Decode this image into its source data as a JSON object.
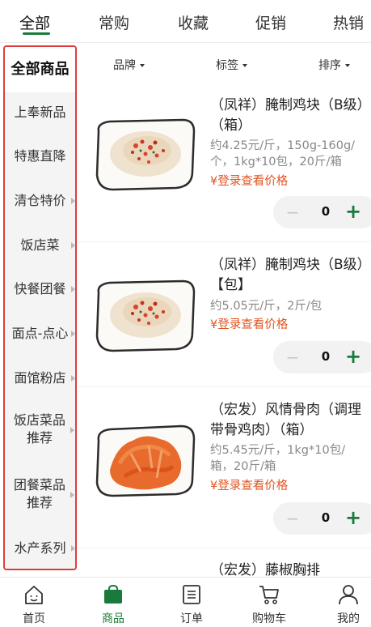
{
  "top_tabs": [
    {
      "label": "全部",
      "active": true
    },
    {
      "label": "常购",
      "active": false
    },
    {
      "label": "收藏",
      "active": false
    },
    {
      "label": "促销",
      "active": false
    },
    {
      "label": "热销",
      "active": false
    }
  ],
  "sidebar": {
    "items": [
      {
        "label": "全部商品",
        "active": true
      },
      {
        "label": "上奉新品"
      },
      {
        "label": "特惠直降"
      },
      {
        "label": "清仓特价"
      },
      {
        "label": "饭店菜"
      },
      {
        "label": "快餐团餐"
      },
      {
        "label": "面点-点心"
      },
      {
        "label": "面馆粉店"
      },
      {
        "label": "饭店菜品推荐"
      },
      {
        "label": "团餐菜品推荐"
      },
      {
        "label": "水产系列"
      }
    ]
  },
  "filters": [
    {
      "label": "品牌"
    },
    {
      "label": "标签"
    },
    {
      "label": "排序"
    }
  ],
  "products": [
    {
      "name": "（凤祥）腌制鸡块（B级）（箱）",
      "spec": "约4.25元/斤，150g-160g/个，1kg*10包，20斤/箱",
      "price": "¥登录查看价格",
      "quantity": "0"
    },
    {
      "name": "（凤祥）腌制鸡块（B级）【包】",
      "spec": "约5.05元/斤，2斤/包",
      "price": "¥登录查看价格",
      "quantity": "0"
    },
    {
      "name": "（宏发）风情骨肉（调理带骨鸡肉）（箱）",
      "spec": "约5.45元/斤，1kg*10包/箱，20斤/箱",
      "price": "¥登录查看价格",
      "quantity": "0"
    },
    {
      "name": "（宏发）藤椒胸排",
      "spec": "",
      "price": "",
      "quantity": ""
    }
  ],
  "stepper": {
    "minus": "−",
    "plus": "+"
  },
  "bottom_nav": [
    {
      "label": "首页",
      "icon": "home-icon",
      "active": false
    },
    {
      "label": "商品",
      "icon": "shopping-bag-icon",
      "active": true
    },
    {
      "label": "订单",
      "icon": "order-list-icon",
      "active": false
    },
    {
      "label": "购物车",
      "icon": "cart-icon",
      "active": false
    },
    {
      "label": "我的",
      "icon": "user-icon",
      "active": false
    }
  ],
  "colors": {
    "accent": "#1a7a3b",
    "price": "#e0531f",
    "highlight_border": "#e03c3c"
  }
}
